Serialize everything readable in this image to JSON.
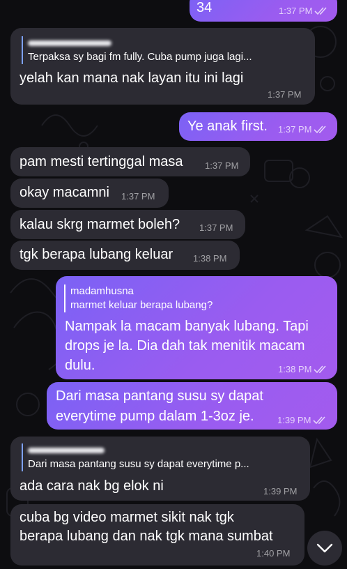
{
  "messages": [
    {
      "id": "m0",
      "direction": "outgoing",
      "text": "34",
      "time": "1:37 PM",
      "read": true
    },
    {
      "id": "m1",
      "direction": "incoming",
      "reply": {
        "text": "Terpaksa sy bagi fm fully. Cuba pump juga lagi..."
      },
      "text": "yelah kan mana nak layan itu ini lagi",
      "time": "1:37 PM"
    },
    {
      "id": "m2",
      "direction": "outgoing",
      "text": "Ye anak first.",
      "time": "1:37 PM",
      "read": true
    },
    {
      "id": "m3",
      "direction": "incoming",
      "text": "pam mesti tertinggal masa",
      "time": "1:37 PM"
    },
    {
      "id": "m4",
      "direction": "incoming",
      "text": "okay macamni",
      "time": "1:37 PM"
    },
    {
      "id": "m5",
      "direction": "incoming",
      "text": "kalau skrg marmet boleh?",
      "time": "1:37 PM"
    },
    {
      "id": "m6",
      "direction": "incoming",
      "text": "tgk berapa lubang keluar",
      "time": "1:38 PM"
    },
    {
      "id": "m7",
      "direction": "outgoing",
      "reply": {
        "name": "madamhusna",
        "text": "marmet keluar berapa lubang?"
      },
      "lines": [
        "Nampak la macam banyak lubang. Tapi",
        "drops je la. Dia dah tak menitik macam",
        "dulu."
      ],
      "time": "1:38 PM",
      "read": true
    },
    {
      "id": "m8",
      "direction": "outgoing",
      "lines": [
        "Dari masa pantang susu sy dapat",
        "everytime pump dalam 1-3oz je."
      ],
      "time": "1:39 PM",
      "read": true
    },
    {
      "id": "m9",
      "direction": "incoming",
      "reply": {
        "text": "Dari masa pantang susu sy dapat everytime p..."
      },
      "text": "ada cara nak bg elok ni",
      "time": "1:39 PM"
    },
    {
      "id": "m10",
      "direction": "incoming",
      "lines": [
        "cuba bg video marmet sikit nak tgk",
        "berapa lubang dan nak tgk mana sumbat"
      ],
      "time": "1:40 PM"
    }
  ],
  "colors": {
    "background": "#0d0d10",
    "incoming_bubble": "#2c2b33",
    "outgoing_bubble_start": "#7b62f5",
    "outgoing_bubble_end": "#a35bee",
    "reply_accent": "#7ea2ff"
  },
  "icons": {
    "read_receipt": "double-check-icon",
    "scroll_down": "chevron-down-icon"
  }
}
